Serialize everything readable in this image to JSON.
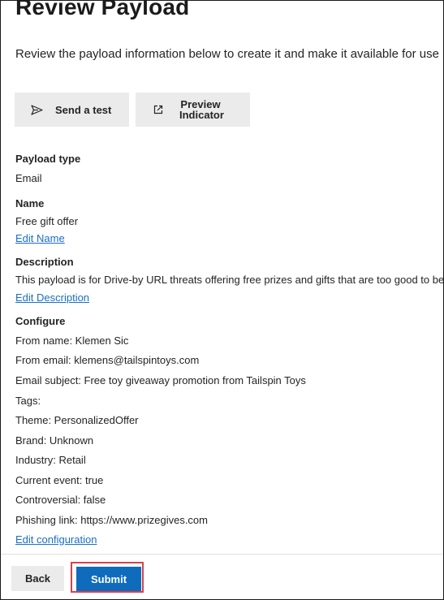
{
  "page": {
    "title": "Review Payload",
    "subtitle": "Review the payload information below to create it and make it available for use in"
  },
  "actions": {
    "send_test_label": "Send a test",
    "preview_label": "Preview\nIndicator"
  },
  "payload_type": {
    "label": "Payload type",
    "value": "Email"
  },
  "name": {
    "label": "Name",
    "value": "Free gift offer",
    "edit_link": "Edit Name"
  },
  "description": {
    "label": "Description",
    "value": "This payload is for Drive-by URL threats offering free prizes and gifts that are too good to be",
    "edit_link": "Edit Description"
  },
  "configure": {
    "label": "Configure",
    "lines": [
      "From name: Klemen Sic",
      "From email: klemens@tailspintoys.com",
      "Email subject: Free toy giveaway promotion from Tailspin Toys",
      "Tags:",
      "Theme: PersonalizedOffer",
      "Brand: Unknown",
      "Industry: Retail",
      "Current event: true",
      "Controversial: false",
      "Phishing link: https://www.prizegives.com"
    ],
    "edit_link": "Edit configuration"
  },
  "footer": {
    "back_label": "Back",
    "submit_label": "Submit"
  },
  "colors": {
    "link": "#1a6fc4",
    "primary": "#0f6cbd",
    "highlight": "#d9414a",
    "secondary_button": "#ebebeb"
  },
  "icons": {
    "send": "send-icon",
    "preview": "open-external-icon"
  }
}
